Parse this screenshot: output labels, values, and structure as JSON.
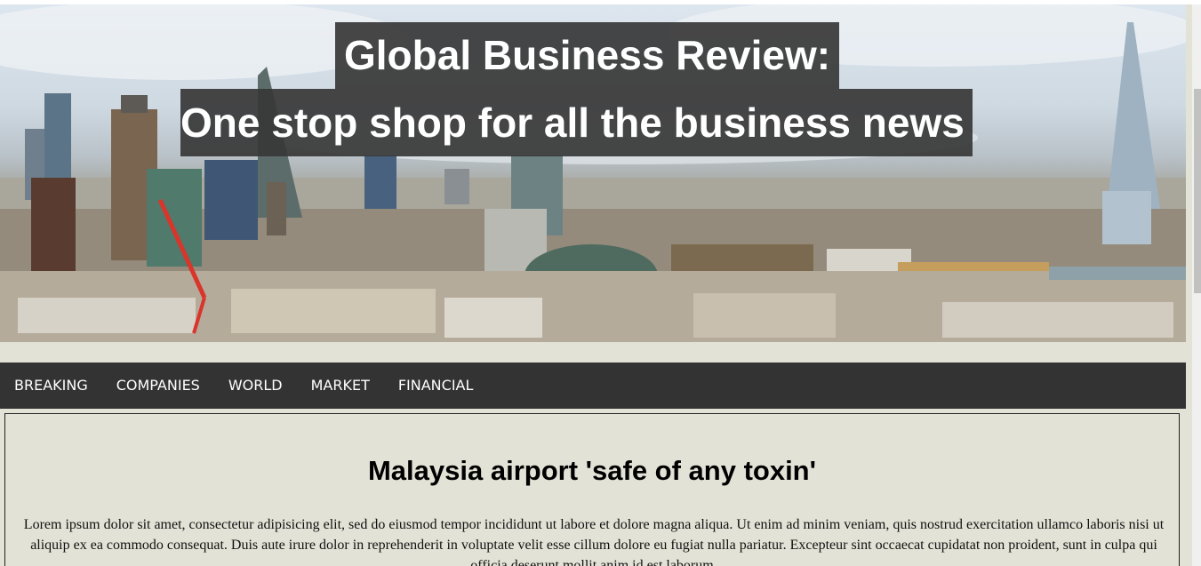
{
  "hero": {
    "title": "Global Business Review:",
    "subtitle": "One stop shop for all the business news"
  },
  "nav": {
    "items": [
      {
        "label": "BREAKING"
      },
      {
        "label": "COMPANIES"
      },
      {
        "label": "WORLD"
      },
      {
        "label": "MARKET"
      },
      {
        "label": "FINANCIAL"
      }
    ]
  },
  "article": {
    "title": "Malaysia airport 'safe of any toxin'",
    "body": "Lorem ipsum dolor sit amet, consectetur adipisicing elit, sed do eiusmod tempor incididunt ut labore et dolore magna aliqua. Ut enim ad minim veniam, quis nostrud exercitation ullamco laboris nisi ut aliquip ex ea commodo consequat. Duis aute irure dolor in reprehenderit in voluptate velit esse cillum dolore eu fugiat nulla pariatur. Excepteur sint occaecat cupidatat non proident, sunt in culpa qui officia deserunt mollit anim id est laborum."
  },
  "colors": {
    "page_background": "#e2e2d6",
    "nav_background": "#333333",
    "banner_overlay": "#373737"
  }
}
